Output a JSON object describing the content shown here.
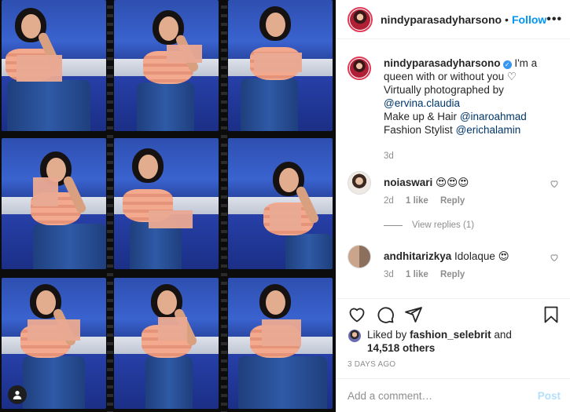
{
  "post": {
    "username": "nindyparasadyharsono",
    "separator": "•",
    "follow_label": "Follow",
    "more_label": "•••",
    "caption": {
      "text_1": "I'm a queen with or without you ♡",
      "text_2": "Virtually photographed by",
      "mention_photographer": "@ervina.claudia",
      "text_3": "Make up & Hair",
      "mention_mua": "@inaroahmad",
      "text_4": "Fashion Stylist",
      "mention_stylist": "@erichalamin",
      "time": "3d"
    }
  },
  "comments": [
    {
      "username": "noiaswari",
      "text": "😍😍😍",
      "time": "2d",
      "likes": "1 like",
      "reply": "Reply"
    },
    {
      "username": "andhitarizkya",
      "text": "Idolaque 😍",
      "time": "3d",
      "likes": "1 like",
      "reply": "Reply"
    }
  ],
  "view_replies": "View replies (1)",
  "likes": {
    "prefix": "Liked by",
    "liker": "fashion_selebrit",
    "and": "and",
    "others": "14,518 others"
  },
  "timestamp": "3 DAYS AGO",
  "add_comment": {
    "placeholder": "Add a comment…",
    "post_label": "Post"
  },
  "icons": [
    "heart-icon",
    "comment-icon",
    "share-icon",
    "bookmark-icon",
    "verified-icon",
    "user-tag-icon",
    "more-icon"
  ],
  "colors": {
    "link_blue": "#0095f6",
    "mention": "#00376b",
    "muted": "#8e8e8e",
    "post_disabled": "#b2dffc"
  }
}
